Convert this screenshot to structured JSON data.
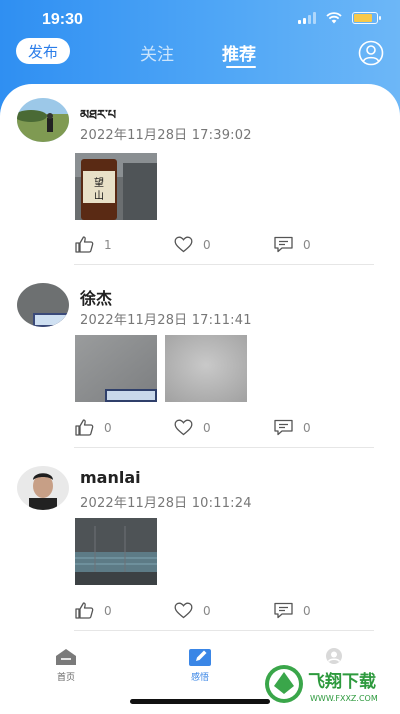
{
  "status_bar": {
    "time": "19:30"
  },
  "header": {
    "publish_label": "发布",
    "tabs": [
      {
        "label": "关注",
        "active": false
      },
      {
        "label": "推荐",
        "active": true
      }
    ]
  },
  "posts": [
    {
      "username": "མཐར་པ",
      "timestamp": "2022年11月28日 17:39:02",
      "likes": "1",
      "favorites": "0",
      "comments": "0",
      "image_count": 1
    },
    {
      "username": "徐杰",
      "timestamp": "2022年11月28日 17:11:41",
      "likes": "0",
      "favorites": "0",
      "comments": "0",
      "image_count": 2
    },
    {
      "username": "manlai",
      "timestamp": "2022年11月28日 10:11:24",
      "likes": "0",
      "favorites": "0",
      "comments": "0",
      "image_count": 1
    }
  ],
  "bottom_nav": {
    "items": [
      {
        "label": "首页",
        "icon": "home-icon",
        "active": false
      },
      {
        "label": "感悟",
        "icon": "edit-note-icon",
        "active": true
      },
      {
        "label": "",
        "icon": "profile-icon",
        "active": false
      }
    ]
  },
  "watermark": {
    "text": "飞翔下载",
    "url_text": "WWW.FXXZ.COM"
  },
  "colors": {
    "header_gradient_start": "#2f8ff2",
    "header_gradient_end": "#6db7f7",
    "accent": "#2b7de9",
    "tab_active": "#3a86e6"
  }
}
